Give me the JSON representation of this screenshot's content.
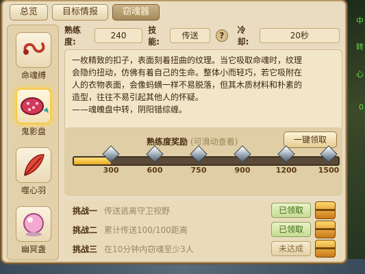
{
  "tabs": [
    {
      "label": "总览"
    },
    {
      "label": "目标情报"
    },
    {
      "label": "窃魂器"
    }
  ],
  "sidebar": {
    "items": [
      {
        "label": "命魂缚",
        "icon": "rope-icon"
      },
      {
        "label": "鬼影盘",
        "icon": "bead-icon"
      },
      {
        "label": "噬心羽",
        "icon": "feather-icon"
      },
      {
        "label": "幽冥盏",
        "icon": "orb-icon"
      }
    ]
  },
  "stats": {
    "proficiency_label": "熟练度:",
    "proficiency_value": "240",
    "skill_label": "技能:",
    "skill_value": "传送",
    "help": "?",
    "cooldown_label": "冷却:",
    "cooldown_value": "20秒"
  },
  "description": {
    "lines": [
      "一枚精致的扣子，表面刻着扭曲的纹理。当它吸取命魂时，纹理",
      "会隐约扭动，仿佛有着自己的生命。整体小而轻巧，若它吸附在",
      "人的衣物表面，会像蚂蟥一样不易脱落，但其木质材料和朴素的",
      "造型，往往不易引起其他人的怀疑。",
      "——魂魄盘中转，阴阳错综缠。"
    ]
  },
  "reward": {
    "title": "熟练度奖励",
    "subtitle": "(可滑动查看)",
    "claim_all": "一键领取",
    "progress_fraction": 0.14,
    "milestones": [
      "300",
      "600",
      "750",
      "900",
      "1200",
      "1500"
    ]
  },
  "challenges": [
    {
      "name": "挑战一",
      "desc": "传送逃离守卫视野",
      "status": "已领取",
      "state": "done"
    },
    {
      "name": "挑战二",
      "desc": "累计传送100/100距离",
      "status": "已领取",
      "state": "done"
    },
    {
      "name": "挑战三",
      "desc": "在10分钟内窃魂至少3人",
      "status": "未达成",
      "state": "notyet"
    }
  ],
  "scene_text": [
    "中",
    "转",
    "心",
    "0"
  ]
}
